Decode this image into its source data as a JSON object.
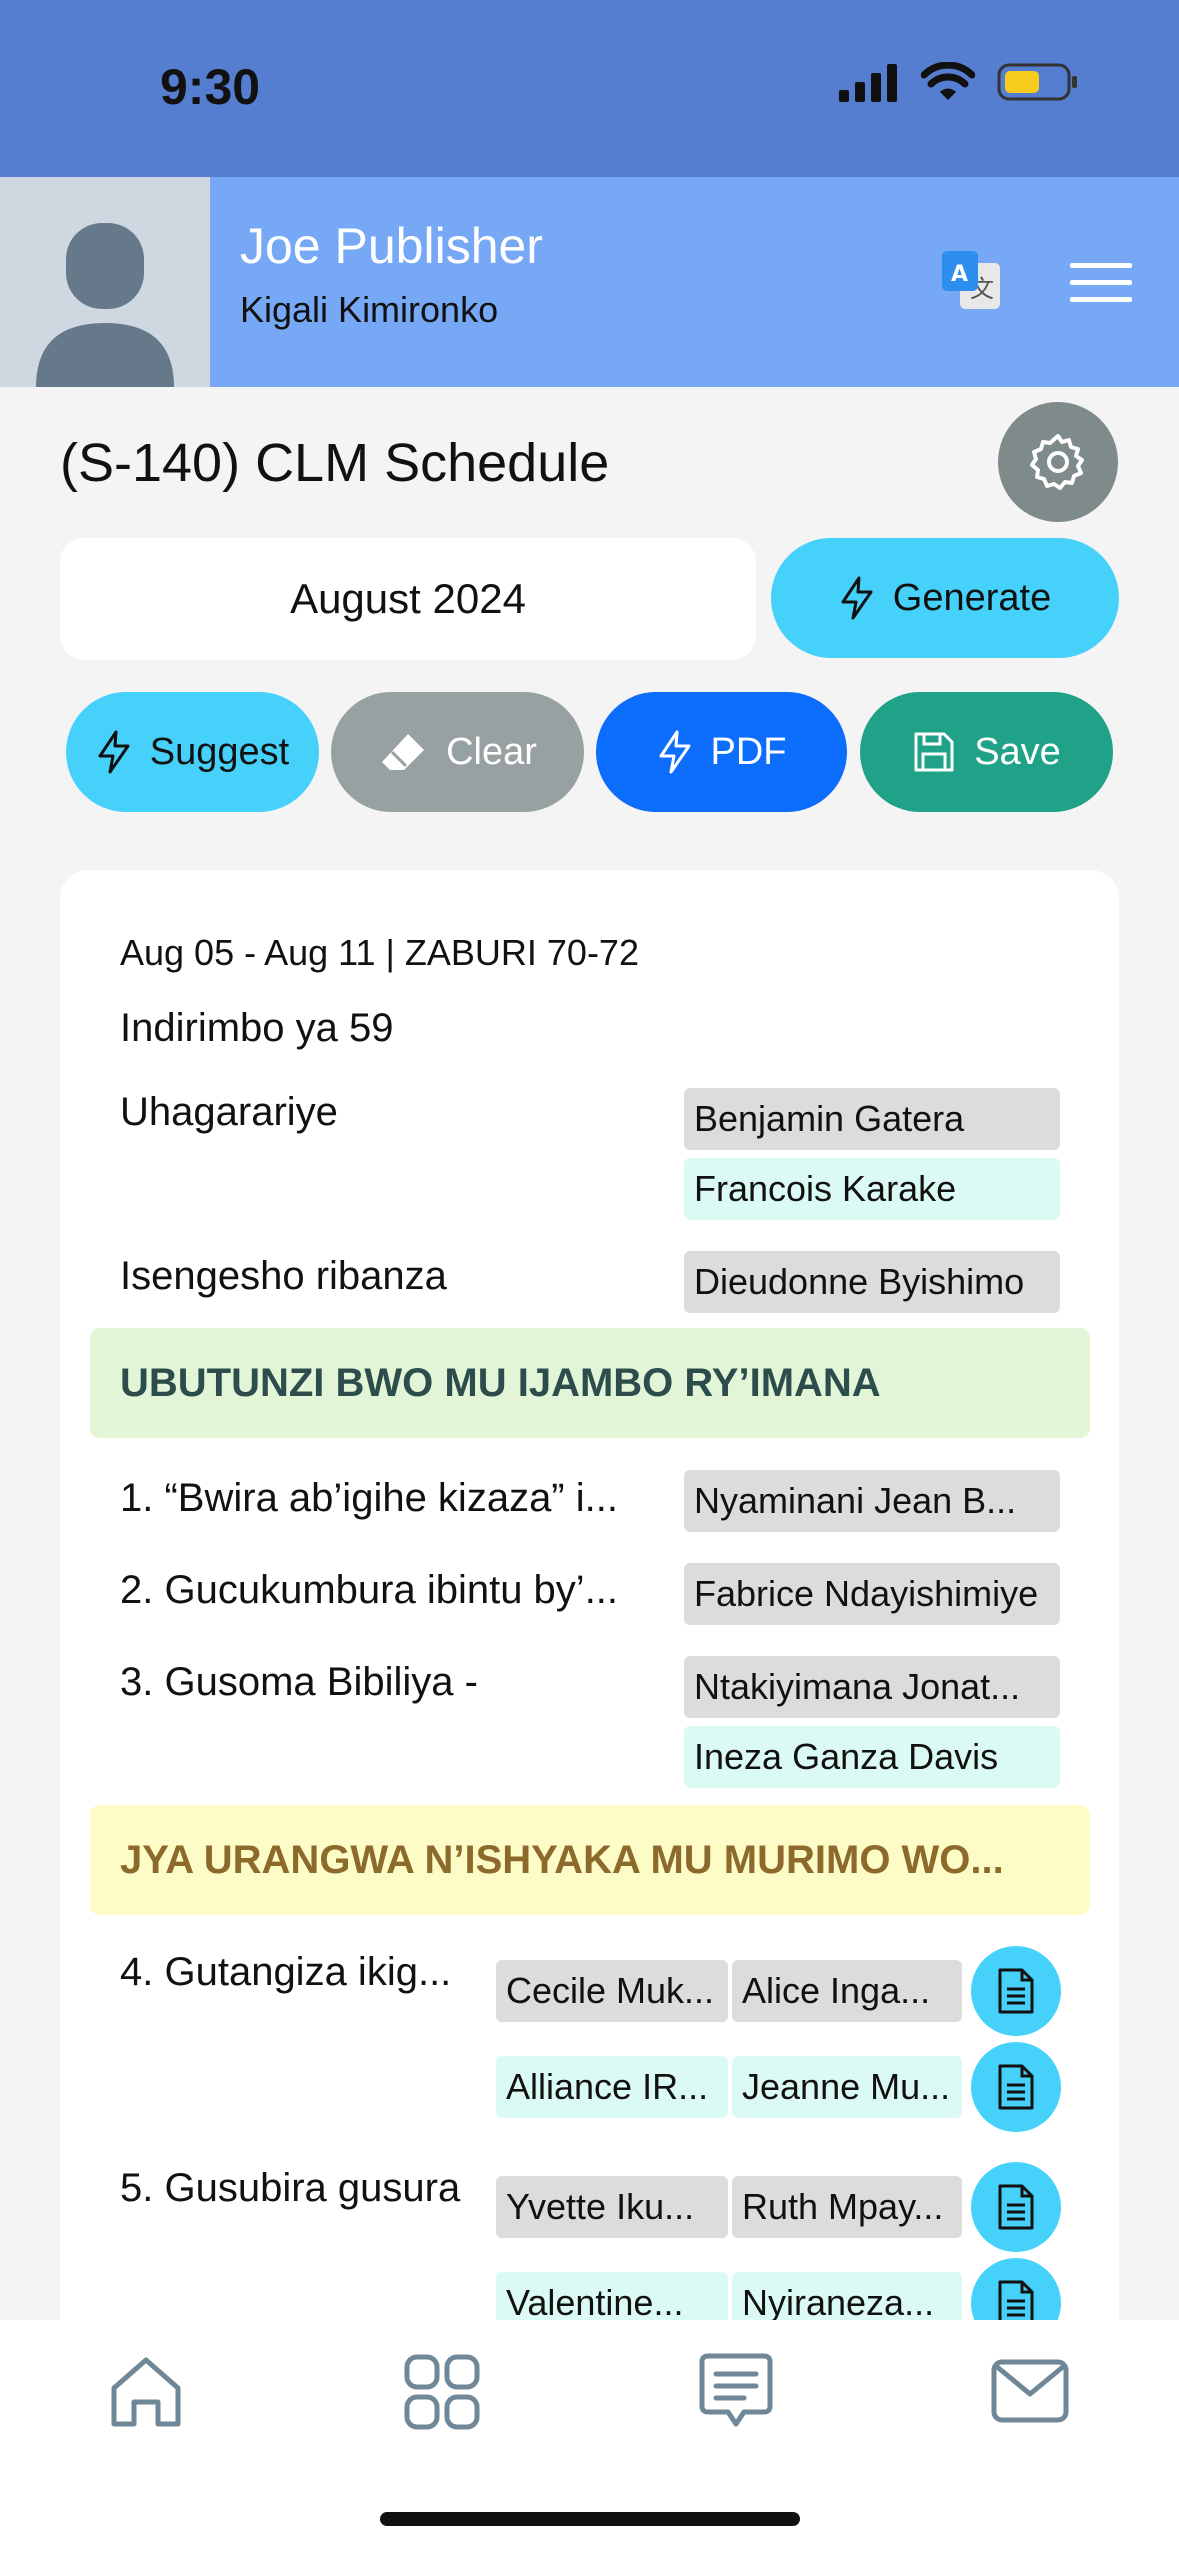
{
  "status": {
    "time": "9:30"
  },
  "user": {
    "name": "Joe Publisher",
    "location": "Kigali Kimironko"
  },
  "page": {
    "title": "(S-140) CLM Schedule"
  },
  "month": "August 2024",
  "buttons": {
    "generate": "Generate",
    "suggest": "Suggest",
    "clear": "Clear",
    "pdf": "PDF",
    "save": "Save"
  },
  "schedule": {
    "week": "Aug 05 - Aug 11 | ZABURI 70-72",
    "song": "Indirimbo ya 59",
    "chairman": {
      "label": "Uhagarariye",
      "names": [
        "Benjamin Gatera",
        "Francois Karake"
      ]
    },
    "opening_prayer": {
      "label": "Isengesho ribanza",
      "name": "Dieudonne Byishimo"
    },
    "section1": "UBUTUNZI BWO MU IJAMBO RY’IMANA",
    "items1": [
      {
        "label": "1. “Bwira ab’igihe kizaza” i...",
        "names": [
          "Nyaminani  Jean B..."
        ]
      },
      {
        "label": "2. Gucukumbura ibintu by’...",
        "names": [
          "Fabrice Ndayishimiye"
        ]
      },
      {
        "label": "3. Gusoma Bibiliya -",
        "names": [
          "Ntakiyimana Jonat...",
          "Ineza Ganza  Davis"
        ]
      }
    ],
    "section2": "JYA URANGWA N’ISHYAKA MU MURIMO WO...",
    "items2": [
      {
        "label": "4. Gutangiza ikig...",
        "pairs": [
          [
            "Cecile Muk...",
            "Alice Inga..."
          ],
          [
            "Alliance IR...",
            "Jeanne Mu..."
          ]
        ]
      },
      {
        "label": "5. Gusubira gusura",
        "pairs": [
          [
            "Yvette Iku...",
            "Ruth Mpay..."
          ],
          [
            "Valentine...",
            "Nyiraneza..."
          ]
        ]
      }
    ]
  },
  "colors": {
    "status_bar": "#567ed0",
    "header": "#77a8f6",
    "cyan": "#46d1fb",
    "grey_button": "#98a1a1",
    "blue_button": "#0d6efd",
    "green_button": "#1fa288",
    "section1_bg": "#e2f5d6",
    "section1_text": "#2d4d4d",
    "section2_bg": "#fefcc6",
    "section2_text": "#8c6a2c"
  }
}
